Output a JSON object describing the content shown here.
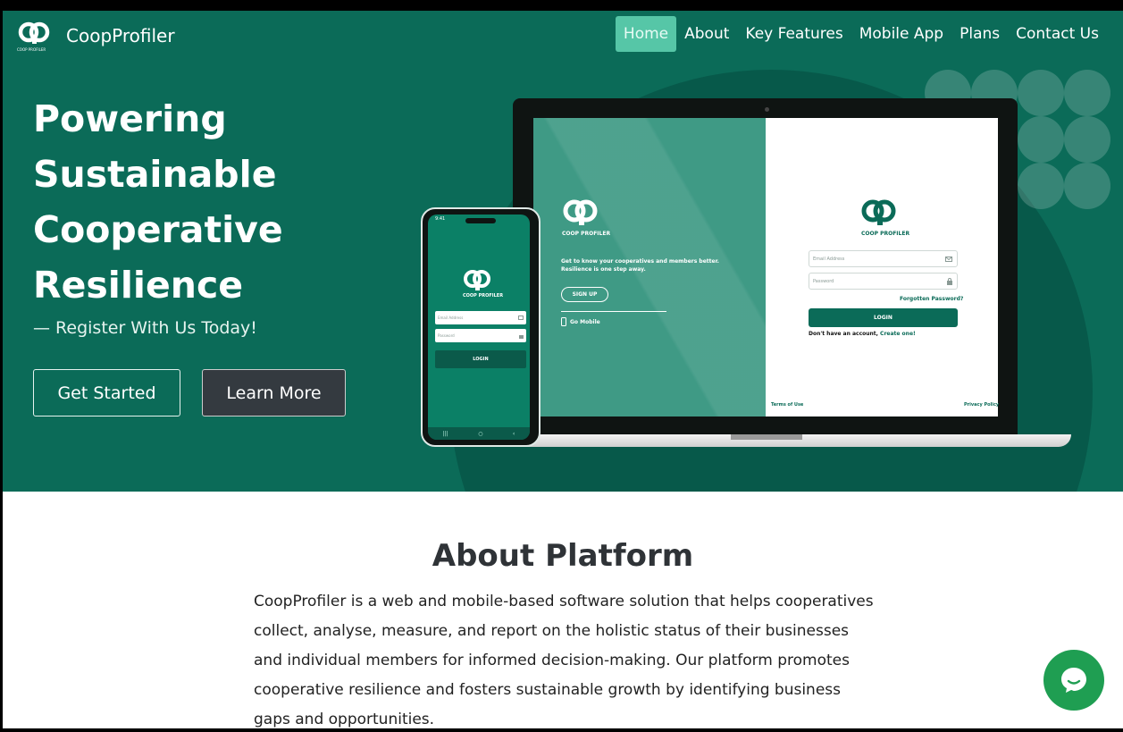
{
  "nav": {
    "brand": "CoopProfiler",
    "logo_caption": "COOP PROFILER",
    "items": [
      {
        "label": "Home",
        "active": true
      },
      {
        "label": "About",
        "active": false
      },
      {
        "label": "Key Features",
        "active": false
      },
      {
        "label": "Mobile App",
        "active": false
      },
      {
        "label": "Plans",
        "active": false
      },
      {
        "label": "Contact Us",
        "active": false
      }
    ]
  },
  "hero": {
    "headline_lines": [
      "Powering",
      "Sustainable",
      "Cooperative",
      "Resilience"
    ],
    "subline": "— Register With Us Today!",
    "buttons": {
      "get_started": "Get Started",
      "learn_more": "Learn More"
    }
  },
  "laptop_screen": {
    "left": {
      "brand": "COOP PROFILER",
      "tagline": "Get to know your cooperatives and members better. Resilience is one step away.",
      "signup": "SIGN UP",
      "go_mobile": "Go Mobile"
    },
    "right": {
      "brand": "COOP PROFILER",
      "email_placeholder": "Email Address",
      "password_placeholder": "Password",
      "forgot": "Forgotten Password?",
      "login": "LOGIN",
      "no_account": "Don't have an account,",
      "create": "Create one!",
      "terms": "Terms of Use",
      "privacy": "Privacy Policy"
    }
  },
  "phone_screen": {
    "time": "9:41",
    "brand": "COOP PROFILER",
    "email_placeholder": "Email Address",
    "password_placeholder": "Password",
    "login": "LOGIN"
  },
  "about": {
    "title": "About Platform",
    "body": "CoopProfiler is a web and mobile-based software solution that helps cooperatives collect, analyse, measure, and report on the holistic status of their businesses and individual members for informed decision-making. Our platform promotes cooperative resilience and fosters sustainable growth by identifying business gaps and opportunities."
  },
  "colors": {
    "hero_bg": "#0b6b58",
    "nav_active": "#56c6a7",
    "learn_more_bg": "#343a40",
    "chat_bg": "#1f9e52"
  },
  "icons": {
    "logo": "coop-logo-icon",
    "chat": "chat-bubble-icon",
    "mail": "mail-icon",
    "lock": "lock-icon",
    "mobile": "mobile-phone-icon"
  }
}
